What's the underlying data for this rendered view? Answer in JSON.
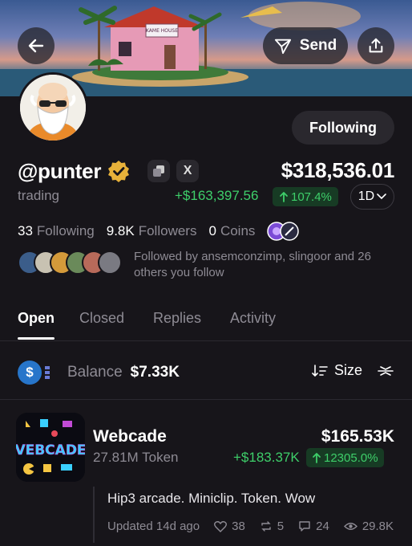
{
  "header": {
    "send_label": "Send",
    "back_icon": "arrow-left-icon",
    "send_icon": "paper-plane-icon",
    "share_icon": "share-upload-icon",
    "banner_sign": "KAME HOUSE"
  },
  "profile": {
    "following_button_label": "Following",
    "handle": "@punter",
    "verified_icon": "verified-badge-icon",
    "x_label": "X",
    "bio": "trading",
    "total_value": "$318,536.01",
    "pnl": "+$163,397.56",
    "pnl_percent": "107.4%",
    "range": "1D",
    "stats": {
      "following_count": "33",
      "following_label": "Following",
      "followers_count": "9.8K",
      "followers_label": "Followers",
      "coins_count": "0",
      "coins_label": "Coins"
    },
    "followed_by_text": "Followed by ansemconzimp, slingoor and 26 others you follow"
  },
  "tabs": [
    {
      "label": "Open",
      "active": true
    },
    {
      "label": "Closed",
      "active": false
    },
    {
      "label": "Replies",
      "active": false
    },
    {
      "label": "Activity",
      "active": false
    }
  ],
  "balance": {
    "label": "Balance",
    "value": "$7.33K",
    "sort_label": "Size",
    "usdc_symbol": "$"
  },
  "holding": {
    "name": "Webcade",
    "amount": "27.81M Token",
    "value": "$165.53K",
    "gain": "+$183.37K",
    "gain_percent": "12305.0%",
    "logo_text": "VEBCADE",
    "post": {
      "text": "Hip3 arcade. Miniclip. Token. Wow",
      "updated": "Updated 14d ago",
      "likes": "38",
      "reposts": "5",
      "comments": "24",
      "views": "29.8K"
    }
  },
  "colors": {
    "background": "#17151a",
    "positive": "#3ecf6a",
    "muted": "#8e8b94",
    "verified": "#e8b23a"
  }
}
